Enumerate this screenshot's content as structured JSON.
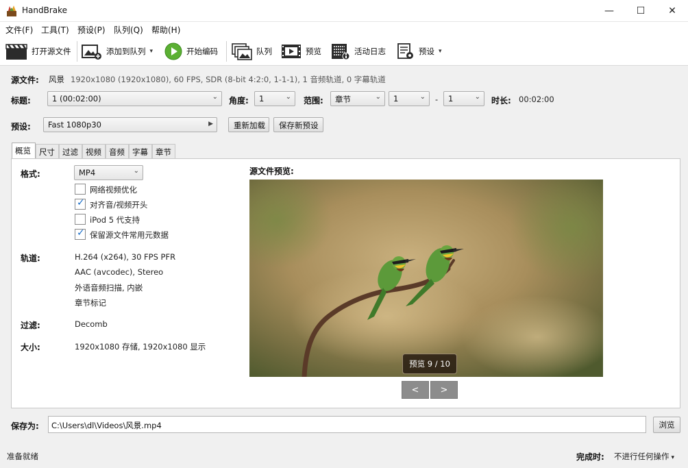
{
  "window": {
    "title": "HandBrake",
    "minimize": "—",
    "maximize": "☐",
    "close": "✕"
  },
  "menu": [
    "文件(F)",
    "工具(T)",
    "预设(P)",
    "队列(Q)",
    "帮助(H)"
  ],
  "toolbar": {
    "open_source": "打开源文件",
    "add_to_queue": "添加到队列",
    "start_encode": "开始编码",
    "queue": "队列",
    "preview": "预览",
    "activity_log": "活动日志",
    "presets": "预设",
    "caret": "▾"
  },
  "source": {
    "label": "源文件:",
    "name": "风景",
    "info": "1920x1080 (1920x1080), 60 FPS, SDR (8-bit 4:2:0, 1-1-1), 1 音频轨道, 0 字幕轨道"
  },
  "title_row": {
    "title_label": "标题:",
    "title_value": "1  (00:02:00)",
    "angle_label": "角度:",
    "angle_value": "1",
    "range_label": "范围:",
    "range_type": "章节",
    "range_start": "1",
    "range_sep": "-",
    "range_end": "1",
    "duration_label": "时长:",
    "duration_value": "00:02:00"
  },
  "preset_row": {
    "label": "预设:",
    "value": "Fast 1080p30",
    "reload": "重新加载",
    "save_new": "保存新预设"
  },
  "tabs": [
    "概览",
    "尺寸",
    "过滤",
    "视频",
    "音频",
    "字幕",
    "章节"
  ],
  "summary": {
    "format_label": "格式:",
    "format_value": "MP4",
    "options": [
      {
        "label": "网络视频优化",
        "checked": false
      },
      {
        "label": "对齐音/视频开头",
        "checked": true
      },
      {
        "label": "iPod 5 代支持",
        "checked": false
      },
      {
        "label": "保留源文件常用元数据",
        "checked": true
      }
    ],
    "tracks_label": "轨道:",
    "tracks": [
      "H.264 (x264), 30 FPS PFR",
      "AAC (avcodec), Stereo",
      "外语音频扫描, 内嵌",
      "章节标记"
    ],
    "filters_label": "过滤:",
    "filters_value": "Decomb",
    "size_label": "大小:",
    "size_value": "1920x1080 存储, 1920x1080 显示"
  },
  "preview": {
    "label": "源文件预览:",
    "badge": "预览 9 / 10",
    "prev": "<",
    "next": ">"
  },
  "save": {
    "label": "保存为:",
    "path": "C:\\Users\\dl\\Videos\\风景.mp4",
    "browse": "浏览"
  },
  "status": {
    "text": "准备就绪",
    "when_done_label": "完成时:",
    "when_done_value": "不进行任何操作"
  }
}
